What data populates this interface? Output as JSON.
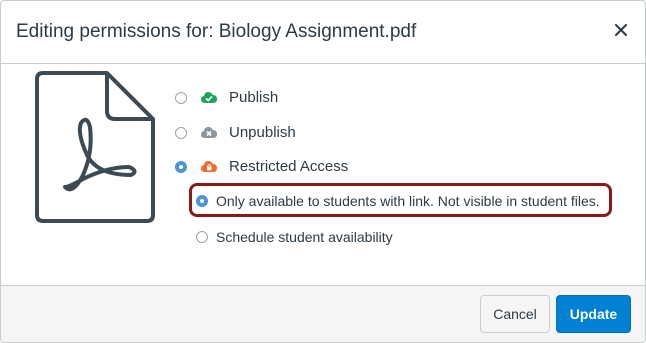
{
  "dialog": {
    "title": "Editing permissions for: Biology Assignment.pdf",
    "close_icon": "close-icon",
    "file_icon": "pdf-file-icon"
  },
  "options": {
    "publish": {
      "label": "Publish",
      "icon": "cloud-check-icon",
      "color": "#23a35f",
      "selected": false
    },
    "unpublish": {
      "label": "Unpublish",
      "icon": "cloud-x-icon",
      "color": "#8c959a",
      "selected": false
    },
    "restricted": {
      "label": "Restricted Access",
      "icon": "cloud-lock-icon",
      "color": "#f26a2d",
      "selected": true
    }
  },
  "restricted_options": {
    "link_only": {
      "label": "Only available to students with link. Not visible in student files.",
      "selected": true
    },
    "schedule": {
      "label": "Schedule student availability",
      "selected": false
    }
  },
  "highlight_color": "#8b1a1a",
  "footer": {
    "cancel_label": "Cancel",
    "update_label": "Update",
    "update_color": "#0081d4"
  }
}
